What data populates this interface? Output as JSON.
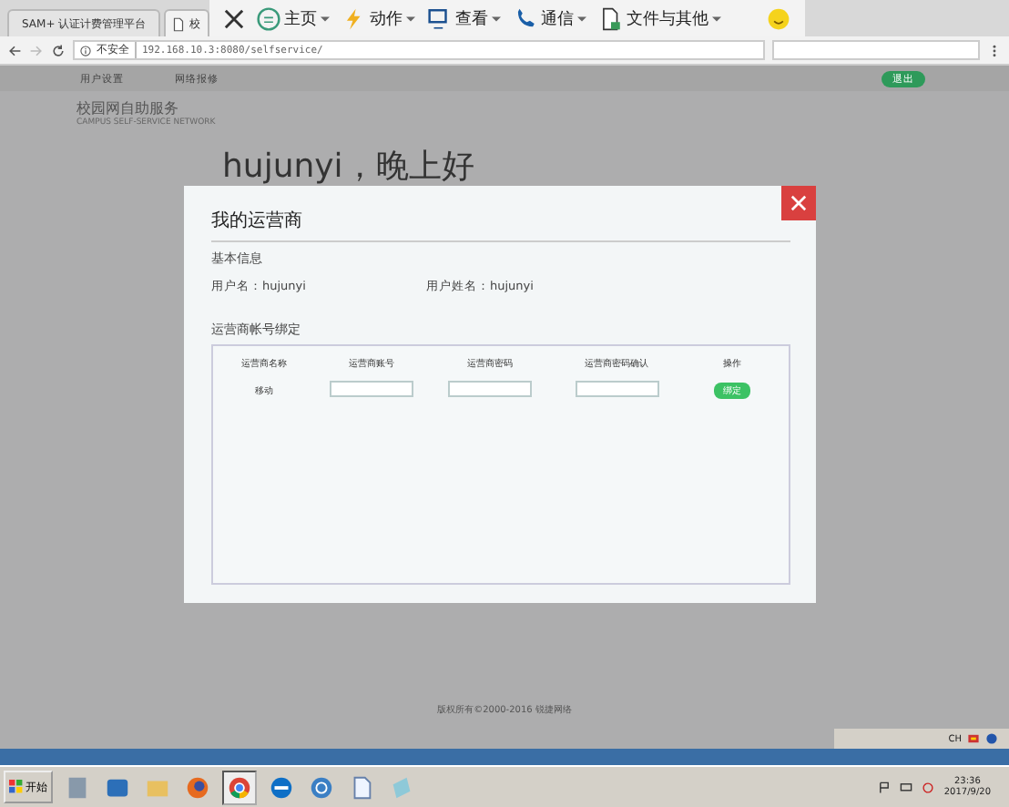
{
  "browser_tabs": [
    {
      "title": "SAM+ 认证计费管理平台",
      "selected": false
    },
    {
      "title": "校",
      "selected": true
    }
  ],
  "address_bar": {
    "security": "不安全",
    "url": "192.168.10.3:8080/selfservice/"
  },
  "remote_toolbar": [
    {
      "label": "主页",
      "kind": "home"
    },
    {
      "label": "动作",
      "kind": "bolt"
    },
    {
      "label": "查看",
      "kind": "view"
    },
    {
      "label": "通信",
      "kind": "phone"
    },
    {
      "label": "文件与其他",
      "kind": "file"
    }
  ],
  "nav": {
    "items": [
      "用户设置",
      "网络报修"
    ],
    "logout": "退出"
  },
  "header": {
    "title": "校园网自助服务",
    "subtitle": "CAMPUS SELF-SERVICE NETWORK",
    "greeting": "hujunyi，晚上好"
  },
  "modal": {
    "title": "我的运营商",
    "basic_section": "基本信息",
    "username": "用户名：hujunyi",
    "full_name": "用户姓名：hujunyi",
    "binding_section": "运营商帐号绑定",
    "columns": [
      "运营商名称",
      "运营商账号",
      "运营商密码",
      "运营商密码确认",
      "操作"
    ],
    "rows": [
      {
        "name": "移动",
        "action": "绑定"
      }
    ]
  },
  "footer": "版权所有©2000-2016 锐捷网络",
  "tray": {
    "lang": "CH"
  },
  "taskbar": {
    "start": "开始",
    "time": "23:36",
    "date": "2017/9/20"
  }
}
